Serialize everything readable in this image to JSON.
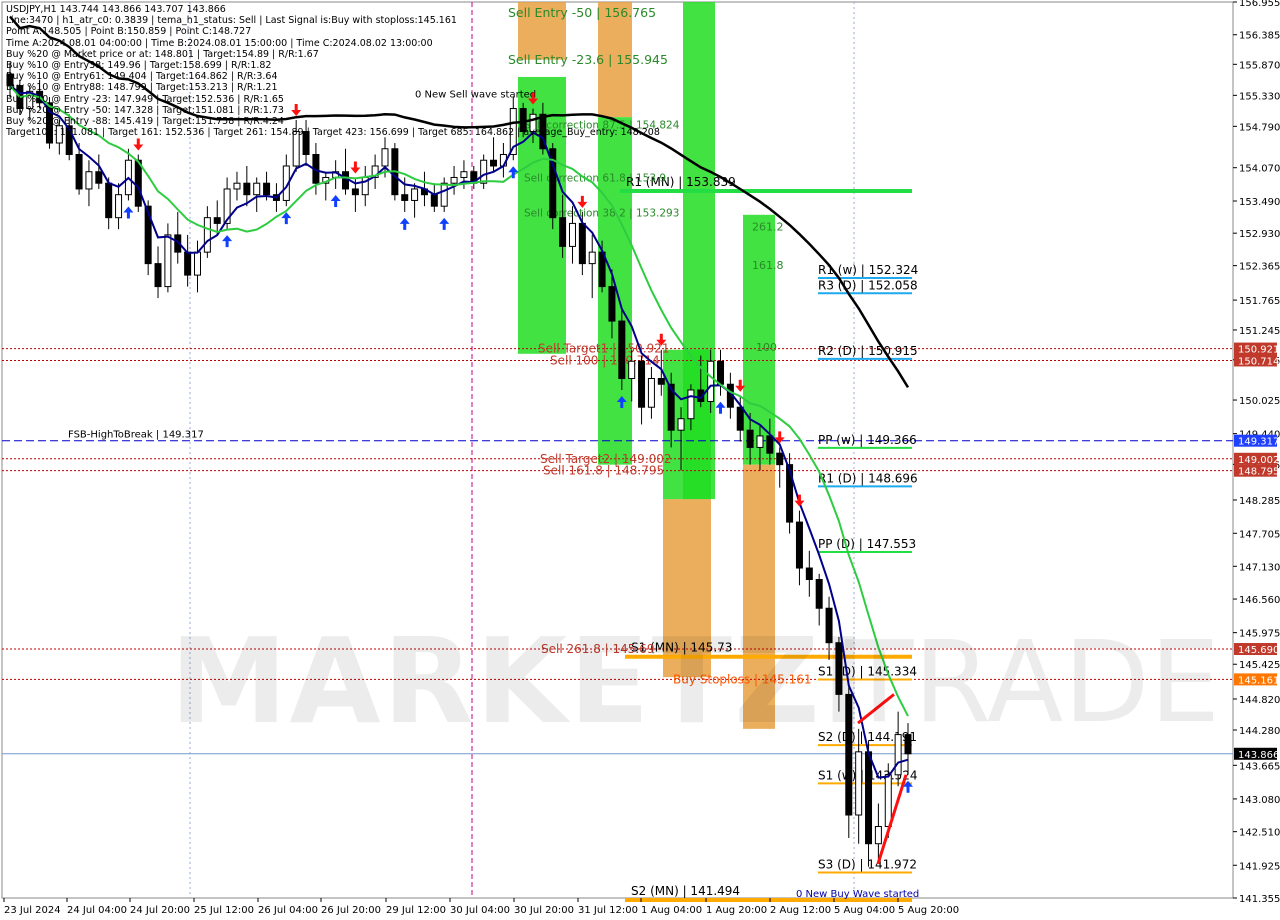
{
  "header": {
    "symbol_line": "USDJPY,H1  143.744 143.866 143.707 143.866",
    "info_lines": [
      "Line:3470 | h1_atr_c0: 0.3839 | tema_h1_status: Sell | Last Signal is:Buy with stoploss:145.161",
      "Point A:148.505 | Point B:150.859 | Point C:148.727",
      "Time A:2024.08.01 04:00:00 | Time B:2024.08.01 15:00:00 | Time C:2024.08.02 13:00:00",
      "Buy %20 @ Market price or at: 148.801 | Target:154.89 | R/R:1.67",
      "Buy %10 @ Entry38: 149.96 | Target:158.699 | R/R:1.82",
      "Buy %10 @ Entry61: 149.404 | Target:164.862 | R/R:3.64",
      "Buy %10 @ Entry88: 148.799 | Target:153.213 | R/R:1.21",
      "Buy %10 @ Entry -23: 147.949 | Target:152.536 | R/R:1.65",
      "Buy %20 @ Entry -50: 147.328 | Target:151.081 | R/R:1.73",
      "Buy %20 @ Entry -88: 145.419 | Target:151.758 | R/R:4.24",
      "Target100: 151.081 | Target 161: 152.536 | Target 261: 154.89 | Target 423: 156.699 | Target 685: 164.862 | average_Buy_entry: 148.208"
    ]
  },
  "watermark": {
    "bold": "MARKETZI",
    "light": "TRADE"
  },
  "colors": {
    "bull": "#000000",
    "bear": "#000000",
    "ema": "#00008b",
    "sma": "#2ecc40",
    "sma_long": "#000000",
    "bright_green": "#22dd22",
    "orange": "#e8a040",
    "pivot_green": "#22dd44",
    "pivot_blue": "#1eaaee",
    "pivot_orange": "#ffaa00",
    "red_line": "#c00000",
    "fsb_blue": "#0000cc",
    "up_arrow": "#1040ff",
    "down_arrow": "#ff1010"
  },
  "chart_data": {
    "type": "candlestick",
    "symbol": "USDJPY",
    "timeframe": "H1",
    "ylim": [
      141.355,
      156.955
    ],
    "y_ticks": [
      "156.955",
      "156.385",
      "155.870",
      "155.330",
      "154.790",
      "154.070",
      "153.490",
      "152.930",
      "152.365",
      "151.765",
      "151.245",
      "150.725",
      "150.025",
      "149.440",
      "148.905",
      "148.285",
      "147.705",
      "147.130",
      "146.560",
      "145.975",
      "145.425",
      "144.820",
      "144.280",
      "143.665",
      "143.080",
      "142.510",
      "141.925",
      "141.355"
    ],
    "x_ticks": [
      "23 Jul 2024",
      "24 Jul 04:00",
      "24 Jul 20:00",
      "25 Jul 12:00",
      "26 Jul 04:00",
      "26 Jul 20:00",
      "29 Jul 12:00",
      "30 Jul 04:00",
      "30 Jul 20:00",
      "31 Jul 12:00",
      "1 Aug 04:00",
      "1 Aug 20:00",
      "2 Aug 12:00",
      "5 Aug 04:00",
      "5 Aug 20:00"
    ],
    "current_price": 143.866,
    "price_badges": [
      {
        "text": "150.921",
        "value": 150.921,
        "color": "#c0392b"
      },
      {
        "text": "150.714",
        "value": 150.714,
        "color": "#c0392b"
      },
      {
        "text": "149.317",
        "value": 149.317,
        "color": "#2040ff"
      },
      {
        "text": "149.002",
        "value": 149.002,
        "color": "#c0392b"
      },
      {
        "text": "148.795",
        "value": 148.795,
        "color": "#c0392b"
      },
      {
        "text": "145.690",
        "value": 145.69,
        "color": "#c0392b"
      },
      {
        "text": "145.161",
        "value": 145.161,
        "color": "#ff7700"
      },
      {
        "text": "143.866",
        "value": 143.866,
        "color": "#000000"
      }
    ],
    "pivot_levels": [
      {
        "label": "R1 (w) | 152.324",
        "value": 152.324,
        "color": "#1eaaee"
      },
      {
        "label": "R3 (D) | 152.058",
        "value": 152.058,
        "color": "#1eaaee"
      },
      {
        "label": "R2 (D) | 150.915",
        "value": 150.915,
        "color": "#1eaaee"
      },
      {
        "label": "PP (w) | 149.366",
        "value": 149.366,
        "color": "#22dd44"
      },
      {
        "label": "R1 (D) | 148.696",
        "value": 148.696,
        "color": "#1eaaee"
      },
      {
        "label": "PP (D) | 147.553",
        "value": 147.553,
        "color": "#22dd44"
      },
      {
        "label": "S1 (D) | 145.334",
        "value": 145.334,
        "color": "#ffaa00"
      },
      {
        "label": "S2 (D) | 144.191",
        "value": 144.191,
        "color": "#ffaa00"
      },
      {
        "label": "S1 (w) | 143.524",
        "value": 143.524,
        "color": "#ffaa00"
      },
      {
        "label": "S3 (D) | 141.972",
        "value": 141.972,
        "color": "#ffaa00"
      }
    ],
    "monthly_levels": [
      {
        "label": "R1 (MN) | 153.839",
        "value": 153.839,
        "color": "#22dd44"
      },
      {
        "label": "S1 (MN) | 145.73",
        "value": 145.73,
        "color": "#ffaa00"
      },
      {
        "label": "S2 (MN) | 141.494",
        "value": 141.494,
        "color": "#ffaa00"
      }
    ],
    "red_levels": [
      150.921,
      150.714,
      149.002,
      148.795,
      145.69,
      145.161
    ],
    "fsb_level": {
      "label": "FSB-HighToBreak | 149.317",
      "value": 149.317
    },
    "annotations": [
      {
        "text": "Sell Entry -50 | 156.765",
        "value": 156.765,
        "color": "#2a8a2a"
      },
      {
        "text": "Sell Entry -23.6 | 155.945",
        "value": 155.945,
        "color": "#2a8a2a"
      },
      {
        "text": "0 New Sell wave started",
        "value": 155.36,
        "color": "#000000"
      },
      {
        "text": "Sell correction 87.5 | 154.824",
        "value": 154.824,
        "color": "#2a8a2a"
      },
      {
        "text": "Sell correction 61.8 | 153.9",
        "value": 153.9,
        "color": "#2a8a2a"
      },
      {
        "text": "Sell correction 38.2 | 153.293",
        "value": 153.293,
        "color": "#2a8a2a"
      },
      {
        "text": "Sell Target1 | 150.921",
        "value": 150.921,
        "color": "#c0392b"
      },
      {
        "text": "Sell 100 | 150.714",
        "value": 150.714,
        "color": "#c0392b"
      },
      {
        "text": "Sell Target2 | 149.002",
        "value": 149.002,
        "color": "#c0392b"
      },
      {
        "text": "Sell 161.8 | 148.795",
        "value": 148.795,
        "color": "#c0392b"
      },
      {
        "text": "Sell 261.8 | 145.69",
        "value": 145.69,
        "color": "#c0392b"
      },
      {
        "text": "Buy Stoploss | 145.161",
        "value": 145.161,
        "color": "#ff5500"
      },
      {
        "text": "0 New Buy Wave started",
        "value": 141.44,
        "color": "#0000aa"
      }
    ],
    "zone_labels": [
      {
        "text": "100",
        "value": 150.95
      },
      {
        "text": "161.8",
        "value": 152.38
      },
      {
        "text": "261.2",
        "value": 153.05
      }
    ],
    "zones": [
      {
        "name": "sell-entry-zone",
        "color": "#e8a040",
        "top": 156.955,
        "bottom": 155.95
      },
      {
        "name": "sell-entry-zone-green",
        "color": "#22dd22",
        "top": 155.65,
        "bottom": 150.83
      },
      {
        "name": "sell-zone-2-orange",
        "color": "#e8a040",
        "top": 156.955,
        "bottom": 154.95
      },
      {
        "name": "sell-zone-2-green",
        "color": "#22dd22",
        "top": 154.95,
        "bottom": 148.9
      },
      {
        "name": "buy-zone-1-green",
        "color": "#22dd22",
        "top": 156.955,
        "bottom": 148.3
      },
      {
        "name": "buy-zone-1-orange",
        "color": "#e8a040",
        "top": 148.3,
        "bottom": 145.2
      },
      {
        "name": "buy-zone-2-green",
        "color": "#22dd22",
        "top": 153.25,
        "bottom": 148.9
      },
      {
        "name": "buy-zone-2-orange",
        "color": "#e8a040",
        "top": 148.9,
        "bottom": 144.3
      }
    ],
    "candles": [
      [
        155.7,
        155.9,
        155.3,
        155.5
      ],
      [
        155.5,
        155.6,
        155.0,
        155.1
      ],
      [
        155.1,
        155.5,
        154.9,
        155.4
      ],
      [
        155.4,
        155.6,
        155.1,
        155.2
      ],
      [
        155.2,
        155.3,
        154.4,
        154.5
      ],
      [
        154.5,
        154.9,
        154.3,
        154.8
      ],
      [
        154.8,
        155.0,
        154.2,
        154.3
      ],
      [
        154.3,
        154.5,
        153.6,
        153.7
      ],
      [
        153.7,
        154.2,
        153.4,
        154.0
      ],
      [
        154.0,
        154.3,
        153.7,
        153.8
      ],
      [
        153.8,
        153.9,
        153.0,
        153.2
      ],
      [
        153.2,
        153.8,
        153.0,
        153.6
      ],
      [
        153.6,
        154.4,
        153.5,
        154.2
      ],
      [
        154.2,
        154.3,
        153.3,
        153.4
      ],
      [
        153.4,
        153.5,
        152.2,
        152.4
      ],
      [
        152.4,
        152.7,
        151.8,
        152.0
      ],
      [
        152.0,
        153.1,
        151.9,
        152.9
      ],
      [
        152.9,
        153.3,
        152.4,
        152.6
      ],
      [
        152.6,
        152.9,
        152.0,
        152.2
      ],
      [
        152.2,
        152.8,
        151.9,
        152.6
      ],
      [
        152.6,
        153.4,
        152.5,
        153.2
      ],
      [
        153.2,
        153.5,
        152.9,
        153.1
      ],
      [
        153.1,
        153.9,
        153.0,
        153.7
      ],
      [
        153.7,
        154.0,
        153.5,
        153.8
      ],
      [
        153.8,
        154.1,
        153.4,
        153.6
      ],
      [
        153.6,
        153.9,
        153.3,
        153.8
      ],
      [
        153.8,
        154.0,
        153.5,
        153.6
      ],
      [
        153.6,
        153.8,
        153.3,
        153.5
      ],
      [
        153.5,
        154.3,
        153.4,
        154.1
      ],
      [
        154.1,
        154.9,
        154.0,
        154.7
      ],
      [
        154.7,
        154.9,
        154.1,
        154.3
      ],
      [
        154.3,
        154.5,
        153.6,
        153.8
      ],
      [
        153.8,
        154.0,
        153.5,
        153.9
      ],
      [
        153.9,
        154.2,
        153.7,
        154.0
      ],
      [
        154.0,
        154.4,
        153.6,
        153.7
      ],
      [
        153.7,
        153.9,
        153.3,
        153.6
      ],
      [
        153.6,
        154.1,
        153.4,
        153.9
      ],
      [
        153.9,
        154.3,
        153.7,
        154.1
      ],
      [
        154.1,
        154.6,
        153.9,
        154.4
      ],
      [
        154.4,
        154.5,
        153.5,
        153.6
      ],
      [
        153.6,
        153.9,
        153.3,
        153.5
      ],
      [
        153.5,
        153.8,
        153.2,
        153.7
      ],
      [
        153.7,
        154.0,
        153.4,
        153.6
      ],
      [
        153.6,
        153.8,
        153.3,
        153.4
      ],
      [
        153.4,
        153.9,
        153.3,
        153.8
      ],
      [
        153.8,
        154.1,
        153.6,
        153.9
      ],
      [
        153.9,
        154.2,
        153.7,
        154.0
      ],
      [
        154.0,
        154.1,
        153.7,
        153.8
      ],
      [
        153.8,
        154.3,
        153.7,
        154.2
      ],
      [
        154.2,
        154.6,
        154.0,
        154.1
      ],
      [
        154.1,
        154.5,
        153.9,
        154.3
      ],
      [
        154.3,
        155.3,
        154.2,
        155.1
      ],
      [
        155.1,
        155.2,
        154.6,
        154.7
      ],
      [
        154.7,
        155.1,
        154.5,
        155.0
      ],
      [
        155.0,
        155.2,
        154.3,
        154.4
      ],
      [
        154.4,
        154.5,
        153.0,
        153.2
      ],
      [
        153.2,
        153.6,
        152.5,
        152.7
      ],
      [
        152.7,
        153.4,
        152.4,
        153.1
      ],
      [
        153.1,
        153.3,
        152.2,
        152.4
      ],
      [
        152.4,
        152.9,
        151.8,
        152.6
      ],
      [
        152.6,
        152.8,
        151.9,
        152.0
      ],
      [
        152.0,
        152.3,
        151.1,
        151.4
      ],
      [
        151.4,
        151.6,
        150.2,
        150.4
      ],
      [
        150.4,
        150.9,
        150.0,
        150.7
      ],
      [
        150.7,
        150.8,
        149.6,
        149.9
      ],
      [
        149.9,
        150.6,
        149.7,
        150.4
      ],
      [
        150.4,
        150.9,
        150.1,
        150.3
      ],
      [
        150.3,
        150.5,
        149.2,
        149.5
      ],
      [
        149.5,
        149.9,
        148.8,
        149.7
      ],
      [
        149.7,
        150.3,
        149.5,
        150.2
      ],
      [
        150.2,
        150.8,
        149.9,
        150.0
      ],
      [
        150.0,
        150.9,
        149.8,
        150.7
      ],
      [
        150.7,
        150.9,
        150.1,
        150.3
      ],
      [
        150.3,
        150.5,
        149.7,
        149.9
      ],
      [
        149.9,
        150.1,
        149.3,
        149.5
      ],
      [
        149.5,
        149.8,
        148.9,
        149.2
      ],
      [
        149.2,
        149.6,
        148.8,
        149.4
      ],
      [
        149.4,
        149.7,
        148.9,
        149.1
      ],
      [
        149.1,
        149.2,
        148.5,
        148.9
      ],
      [
        148.9,
        149.1,
        147.7,
        147.9
      ],
      [
        147.9,
        148.1,
        146.8,
        147.1
      ],
      [
        147.1,
        147.4,
        146.6,
        146.9
      ],
      [
        146.9,
        147.0,
        146.1,
        146.4
      ],
      [
        146.4,
        146.6,
        145.5,
        145.8
      ],
      [
        145.8,
        145.9,
        144.6,
        144.9
      ],
      [
        144.9,
        145.1,
        142.4,
        142.8
      ],
      [
        142.8,
        144.3,
        142.3,
        143.9
      ],
      [
        143.9,
        144.1,
        141.9,
        142.3
      ],
      [
        142.3,
        143.0,
        142.0,
        142.6
      ],
      [
        142.6,
        143.7,
        142.4,
        143.5
      ],
      [
        143.5,
        144.6,
        143.3,
        144.2
      ],
      [
        144.2,
        144.4,
        143.5,
        143.866
      ]
    ]
  }
}
